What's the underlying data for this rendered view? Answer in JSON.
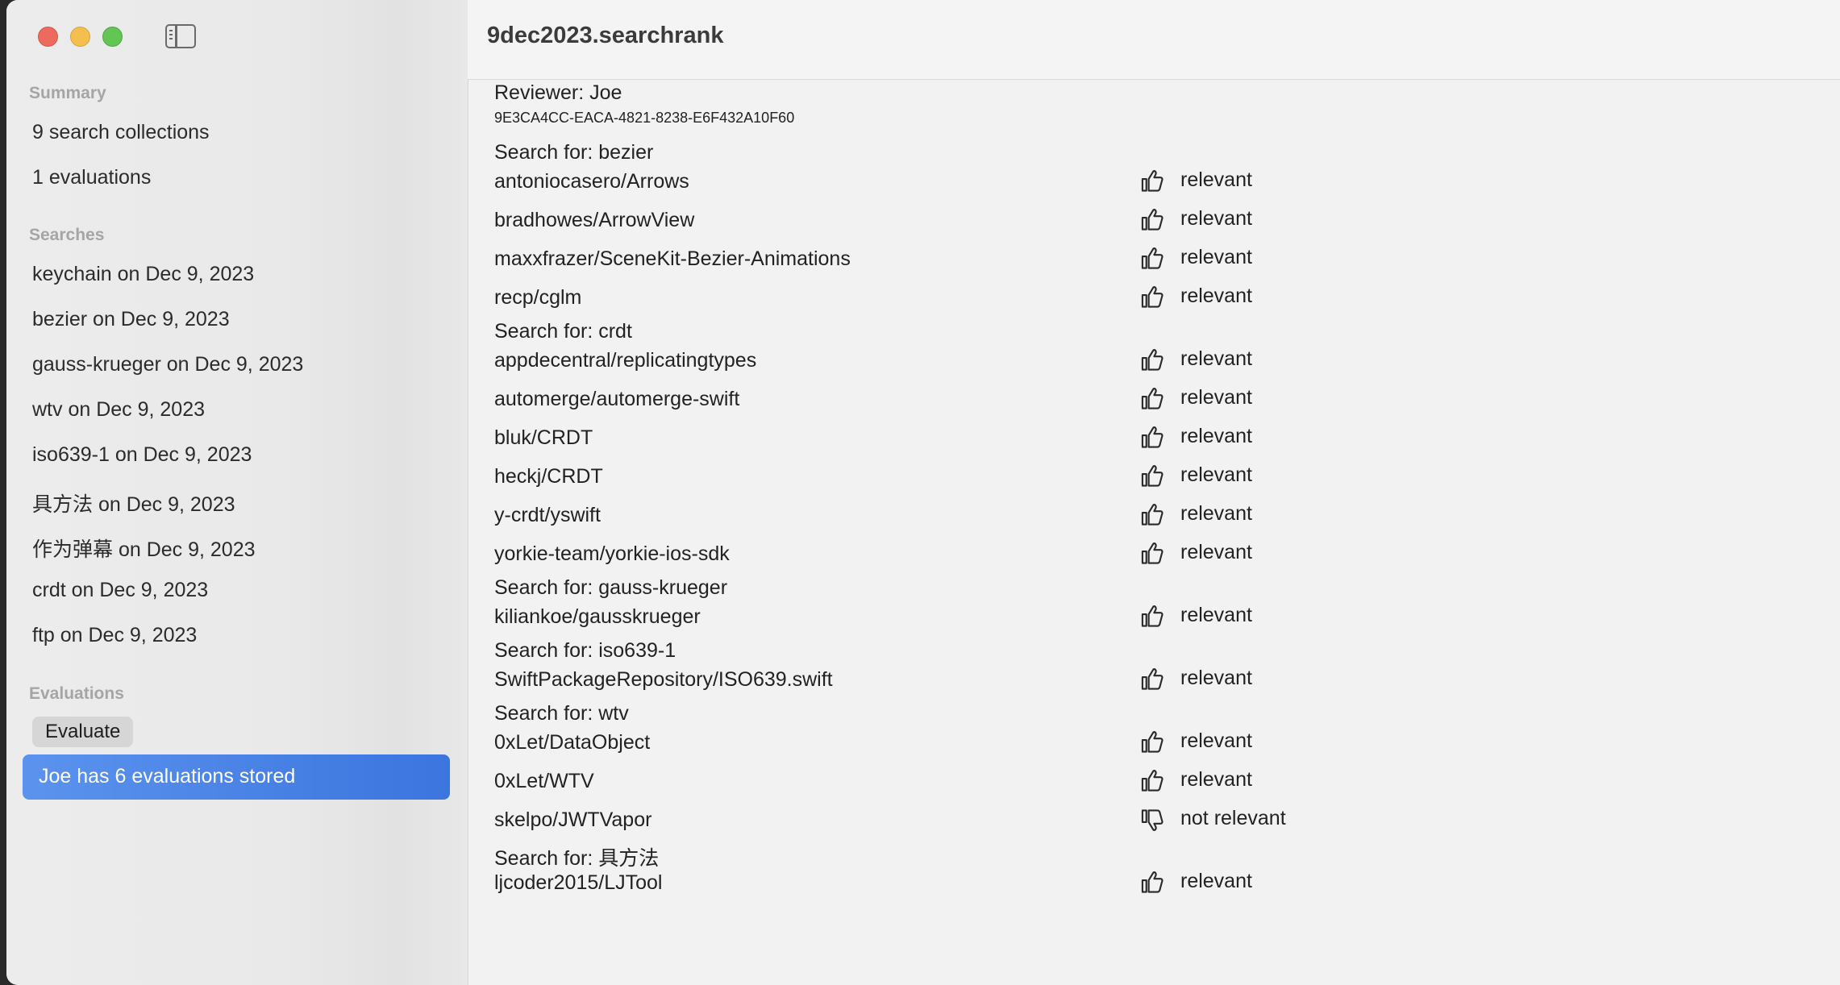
{
  "window": {
    "title": "9dec2023.searchrank"
  },
  "sidebar": {
    "summary_header": "Summary",
    "summary_items": [
      "9 search collections",
      "1 evaluations"
    ],
    "searches_header": "Searches",
    "searches": [
      "keychain on Dec 9, 2023",
      "bezier on Dec 9, 2023",
      "gauss-krueger on Dec 9, 2023",
      "wtv on Dec 9, 2023",
      "iso639-1 on Dec 9, 2023",
      "具方法 on Dec 9, 2023",
      "作为弹幕 on Dec 9, 2023",
      "crdt on Dec 9, 2023",
      "ftp on Dec 9, 2023"
    ],
    "evaluations_header": "Evaluations",
    "evaluate_button": "Evaluate",
    "selected_item": "Joe has 6 evaluations stored"
  },
  "main": {
    "reviewer": "Reviewer: Joe",
    "uuid": "9E3CA4CC-EACA-4821-8238-E6F432A10F60",
    "groups": [
      {
        "search": "Search for: bezier",
        "results": [
          {
            "repo": "antoniocasero/Arrows",
            "rating": "relevant",
            "icon": "thumbs-up"
          },
          {
            "repo": "bradhowes/ArrowView",
            "rating": "relevant",
            "icon": "thumbs-up"
          },
          {
            "repo": "maxxfrazer/SceneKit-Bezier-Animations",
            "rating": "relevant",
            "icon": "thumbs-up"
          },
          {
            "repo": "recp/cglm",
            "rating": "relevant",
            "icon": "thumbs-up"
          }
        ]
      },
      {
        "search": "Search for: crdt",
        "results": [
          {
            "repo": "appdecentral/replicatingtypes",
            "rating": "relevant",
            "icon": "thumbs-up"
          },
          {
            "repo": "automerge/automerge-swift",
            "rating": "relevant",
            "icon": "thumbs-up"
          },
          {
            "repo": "bluk/CRDT",
            "rating": "relevant",
            "icon": "thumbs-up"
          },
          {
            "repo": "heckj/CRDT",
            "rating": "relevant",
            "icon": "thumbs-up"
          },
          {
            "repo": "y-crdt/yswift",
            "rating": "relevant",
            "icon": "thumbs-up"
          },
          {
            "repo": "yorkie-team/yorkie-ios-sdk",
            "rating": "relevant",
            "icon": "thumbs-up"
          }
        ]
      },
      {
        "search": "Search for: gauss-krueger",
        "results": [
          {
            "repo": "kiliankoe/gausskrueger",
            "rating": "relevant",
            "icon": "thumbs-up"
          }
        ]
      },
      {
        "search": "Search for: iso639-1",
        "results": [
          {
            "repo": "SwiftPackageRepository/ISO639.swift",
            "rating": "relevant",
            "icon": "thumbs-up"
          }
        ]
      },
      {
        "search": "Search for: wtv",
        "results": [
          {
            "repo": "0xLet/DataObject",
            "rating": "relevant",
            "icon": "thumbs-up"
          },
          {
            "repo": "0xLet/WTV",
            "rating": "relevant",
            "icon": "thumbs-up"
          },
          {
            "repo": "skelpo/JWTVapor",
            "rating": "not relevant",
            "icon": "thumbs-down"
          }
        ]
      },
      {
        "search": "Search for: 具方法",
        "results": [
          {
            "repo": "ljcoder2015/LJTool",
            "rating": "relevant",
            "icon": "thumbs-up"
          }
        ]
      }
    ]
  }
}
